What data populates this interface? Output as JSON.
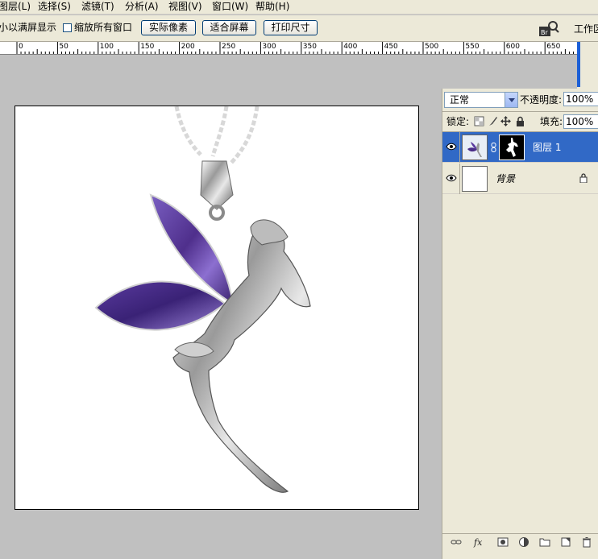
{
  "menu": {
    "items": [
      "图层(L)",
      "选择(S)",
      "滤镜(T)",
      "分析(A)",
      "视图(V)",
      "窗口(W)",
      "帮助(H)"
    ]
  },
  "options": {
    "fit_screen_label": "小以满屏显示",
    "zoom_all_windows_label": "缩放所有窗口",
    "zoom_all_windows_checked": false,
    "actual_pixels_button": "实际像素",
    "fit_screen_button": "适合屏幕",
    "print_size_button": "打印尺寸",
    "bridge_icon": "Br",
    "workspace_label": "工作区"
  },
  "ruler": {
    "labels": [
      "0",
      "50",
      "100",
      "150",
      "200",
      "250",
      "300",
      "350",
      "400",
      "450",
      "500",
      "550",
      "600",
      "650"
    ]
  },
  "layers_panel": {
    "blend_mode": "正常",
    "opacity_label": "不透明度:",
    "opacity_value": "100%",
    "lock_label": "锁定:",
    "fill_label": "填充:",
    "fill_value": "100%",
    "layers": [
      {
        "name": "图层 1",
        "visible": true,
        "selected": true,
        "has_mask": true
      },
      {
        "name": "背景",
        "visible": true,
        "selected": false,
        "locked": true
      }
    ],
    "footer_icons": [
      "link-icon",
      "fx-icon",
      "mask-icon",
      "adjustment-icon",
      "group-folder-icon",
      "new-layer-icon",
      "trash-icon"
    ]
  },
  "colors": {
    "selection": "#3169c6",
    "chrome": "#ece9d8",
    "canvas_bg": "#c0c0c0",
    "gem_purple": "#5b3a9e"
  }
}
